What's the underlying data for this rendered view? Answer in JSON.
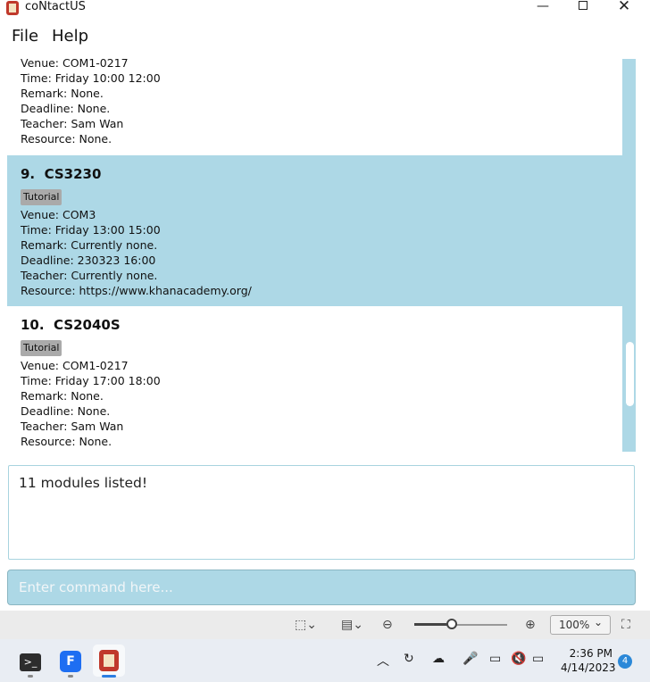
{
  "window": {
    "title": "coNtactUS",
    "minimize": "—",
    "close": "✕"
  },
  "menu": {
    "file": "File",
    "help": "Help"
  },
  "modules": [
    {
      "lines": [
        "Venue: COM1-0217",
        "Time: Friday 10:00 12:00",
        "Remark: None.",
        "Deadline: None.",
        "Teacher: Sam Wan",
        "Resource: None."
      ]
    },
    {
      "index": "9.",
      "code": "CS3230",
      "tag": "Tutorial",
      "lines": [
        "Venue: COM3",
        "Time: Friday 13:00 15:00",
        "Remark: Currently none.",
        "Deadline: 230323 16:00",
        "Teacher: Currently none.",
        "Resource: https://www.khanacademy.org/"
      ]
    },
    {
      "index": "10.",
      "code": "CS2040S",
      "tag": "Tutorial",
      "lines": [
        "Venue: COM1-0217",
        "Time: Friday 17:00 18:00",
        "Remark: None.",
        "Deadline: None.",
        "Teacher: Sam Wan",
        "Resource: None."
      ]
    }
  ],
  "result": {
    "text": "11 modules listed!"
  },
  "command": {
    "placeholder": "Enter command here..."
  },
  "zoombar": {
    "zoom": "100%",
    "zoom_chevron": "⌄"
  },
  "taskbar": {
    "time": "2:36 PM",
    "date": "4/14/2023",
    "notifications": "4",
    "term_glyph": ">_",
    "blue_glyph": "F"
  },
  "colors": {
    "selected": "#add8e6",
    "tag": "#aaaaaa"
  }
}
